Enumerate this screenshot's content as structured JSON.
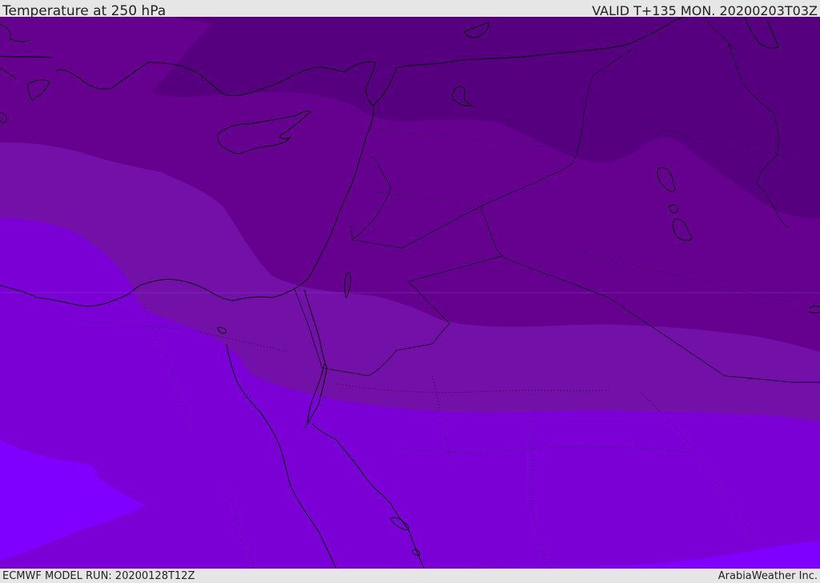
{
  "header": {
    "title": "Temperature at 250 hPa",
    "valid": "VALID T+135 MON. 20200203T03Z"
  },
  "footer": {
    "model_run": "ECMWF MODEL RUN: 20200128T12Z",
    "credit": "ArabiaWeather Inc."
  },
  "colors": {
    "band_coldest": "#56007f",
    "band_cold": "#65008f",
    "band_mid": "#7310a8",
    "band_warm": "#7a00d6",
    "band_warmest": "#7f00ff",
    "coastline": "#000000",
    "border": "#1a0030"
  }
}
